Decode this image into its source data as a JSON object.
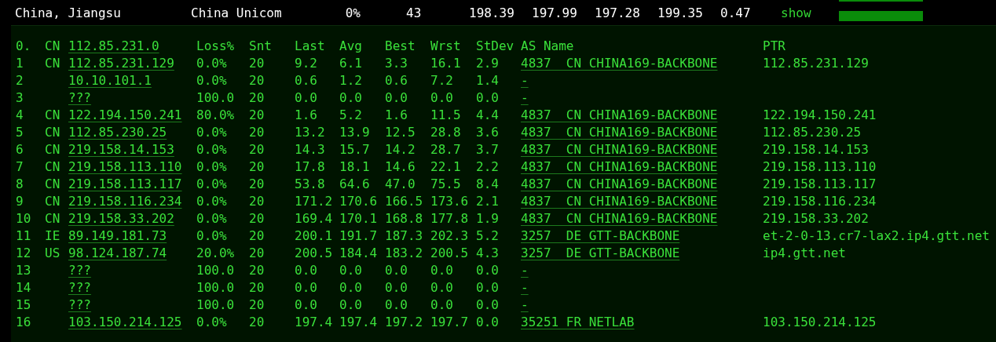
{
  "summary": {
    "location": "China, Jiangsu",
    "isp": "China Unicom",
    "loss": "0%",
    "sent": "43",
    "values": [
      "198.39",
      "197.99",
      "197.28",
      "199.35",
      "0.47"
    ],
    "link": "show"
  },
  "trace": {
    "start": {
      "index": "0.",
      "cc": "CN",
      "host": "112.85.231.0"
    },
    "columns": [
      "Loss%",
      "Snt",
      "Last",
      "Avg",
      "Best",
      "Wrst",
      "StDev",
      "AS Name",
      "PTR"
    ],
    "hops": [
      {
        "index": "1",
        "cc": "CN",
        "host": "112.85.231.129",
        "stats": [
          "0.0%",
          "20",
          "9.2",
          "6.1",
          "3.3",
          "16.1",
          "2.9"
        ],
        "as": "4837  CN CHINA169-BACKBONE",
        "ptr": "112.85.231.129"
      },
      {
        "index": "2",
        "host": "10.10.101.1",
        "stats": [
          "0.0%",
          "20",
          "0.6",
          "1.2",
          "0.6",
          "7.2",
          "1.4"
        ],
        "as": "-"
      },
      {
        "index": "3",
        "host": "???",
        "stats": [
          "100.0",
          "20",
          "0.0",
          "0.0",
          "0.0",
          "0.0",
          "0.0"
        ],
        "as": "-"
      },
      {
        "index": "4",
        "cc": "CN",
        "host": "122.194.150.241",
        "stats": [
          "80.0%",
          "20",
          "1.6",
          "5.2",
          "1.6",
          "11.5",
          "4.4"
        ],
        "as": "4837  CN CHINA169-BACKBONE",
        "ptr": "122.194.150.241"
      },
      {
        "index": "5",
        "cc": "CN",
        "host": "112.85.230.25",
        "stats": [
          "0.0%",
          "20",
          "13.2",
          "13.9",
          "12.5",
          "28.8",
          "3.6"
        ],
        "as": "4837  CN CHINA169-BACKBONE",
        "ptr": "112.85.230.25"
      },
      {
        "index": "6",
        "cc": "CN",
        "host": "219.158.14.153",
        "stats": [
          "0.0%",
          "20",
          "14.3",
          "15.7",
          "14.2",
          "28.7",
          "3.7"
        ],
        "as": "4837  CN CHINA169-BACKBONE",
        "ptr": "219.158.14.153"
      },
      {
        "index": "7",
        "cc": "CN",
        "host": "219.158.113.110",
        "stats": [
          "0.0%",
          "20",
          "17.8",
          "18.1",
          "14.6",
          "22.1",
          "2.2"
        ],
        "as": "4837  CN CHINA169-BACKBONE",
        "ptr": "219.158.113.110"
      },
      {
        "index": "8",
        "cc": "CN",
        "host": "219.158.113.117",
        "stats": [
          "0.0%",
          "20",
          "53.8",
          "64.6",
          "47.0",
          "75.5",
          "8.4"
        ],
        "as": "4837  CN CHINA169-BACKBONE",
        "ptr": "219.158.113.117"
      },
      {
        "index": "9",
        "cc": "CN",
        "host": "219.158.116.234",
        "stats": [
          "0.0%",
          "20",
          "171.2",
          "170.6",
          "166.5",
          "173.6",
          "2.1"
        ],
        "as": "4837  CN CHINA169-BACKBONE",
        "ptr": "219.158.116.234"
      },
      {
        "index": "10",
        "cc": "CN",
        "host": "219.158.33.202",
        "stats": [
          "0.0%",
          "20",
          "169.4",
          "170.1",
          "168.8",
          "177.8",
          "1.9"
        ],
        "as": "4837  CN CHINA169-BACKBONE",
        "ptr": "219.158.33.202"
      },
      {
        "index": "11",
        "cc": "IE",
        "host": "89.149.181.73",
        "stats": [
          "0.0%",
          "20",
          "200.1",
          "191.7",
          "187.3",
          "202.3",
          "5.2"
        ],
        "as": "3257  DE GTT-BACKBONE",
        "ptr": "et-2-0-13.cr7-lax2.ip4.gtt.net"
      },
      {
        "index": "12",
        "cc": "US",
        "host": "98.124.187.74",
        "stats": [
          "20.0%",
          "20",
          "200.5",
          "184.4",
          "183.2",
          "200.5",
          "4.3"
        ],
        "as": "3257  DE GTT-BACKBONE",
        "ptr": "ip4.gtt.net"
      },
      {
        "index": "13",
        "host": "???",
        "stats": [
          "100.0",
          "20",
          "0.0",
          "0.0",
          "0.0",
          "0.0",
          "0.0"
        ],
        "as": "-"
      },
      {
        "index": "14",
        "host": "???",
        "stats": [
          "100.0",
          "20",
          "0.0",
          "0.0",
          "0.0",
          "0.0",
          "0.0"
        ],
        "as": "-"
      },
      {
        "index": "15",
        "host": "???",
        "stats": [
          "100.0",
          "20",
          "0.0",
          "0.0",
          "0.0",
          "0.0",
          "0.0"
        ],
        "as": "-"
      },
      {
        "index": "16",
        "host": "103.150.214.125",
        "stats": [
          "0.0%",
          "20",
          "197.4",
          "197.4",
          "197.2",
          "197.7",
          "0.0"
        ],
        "as": "35251 FR NETLAB",
        "ptr": "103.150.214.125"
      }
    ]
  }
}
